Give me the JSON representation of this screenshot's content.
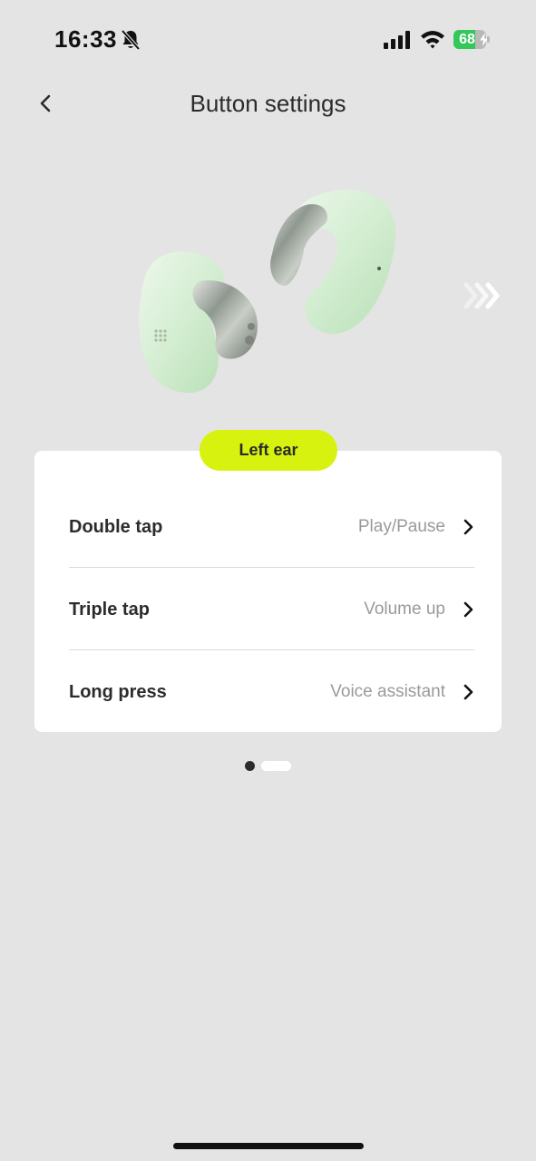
{
  "status_bar": {
    "time": "16:33",
    "battery_percent": "68",
    "battery_level": 0.68,
    "icons": [
      "bell-slash-icon",
      "cellular-signal-icon",
      "wifi-icon",
      "battery-charging-icon"
    ]
  },
  "header": {
    "title": "Button settings",
    "back_icon": "chevron-left-icon"
  },
  "carousel": {
    "next_icon": "double-chevron-right-icon",
    "active_page": 1,
    "page_count": 2
  },
  "card": {
    "badge": "Left ear",
    "badge_color": "#d8f20f",
    "rows": [
      {
        "label": "Double tap",
        "value": "Play/Pause"
      },
      {
        "label": "Triple tap",
        "value": "Volume up"
      },
      {
        "label": "Long press",
        "value": "Voice assistant"
      }
    ]
  },
  "colors": {
    "background": "#e4e4e4",
    "card": "#ffffff",
    "battery_green": "#34c759"
  }
}
